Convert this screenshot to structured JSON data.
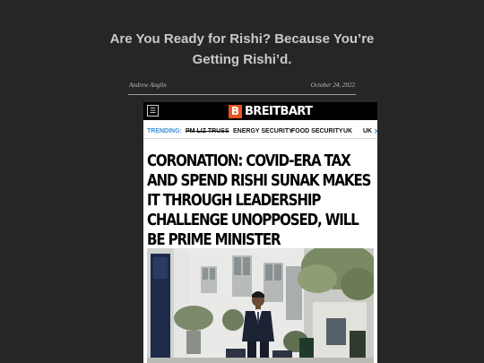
{
  "article": {
    "title": "Are You Ready for Rishi? Because You’re Getting Rishi’d.",
    "author": "Andrew Anglin",
    "date": "October 24, 2022"
  },
  "embedded_screenshot": {
    "menu_icon": "hamburger-menu-icon",
    "brand_logo_letter": "B",
    "brand_name": "BREITBART",
    "brand_color": "#e8541c",
    "trending_label": "TRENDING:",
    "trending_items": [
      "PM LIZ TRUSS",
      "ENERGY SECURITY",
      "FOOD SECURITY",
      "UK",
      "UK"
    ],
    "trending_arrow": "chevron-right-icon",
    "headline": "CORONATION: COVID-ERA TAX AND SPEND RISHI SUNAK MAKES IT THROUGH LEADERSHIP CHALLENGE UNOPPOSED, WILL BE PRIME MINISTER",
    "photo": "rishi-sunak-walking-photo"
  }
}
